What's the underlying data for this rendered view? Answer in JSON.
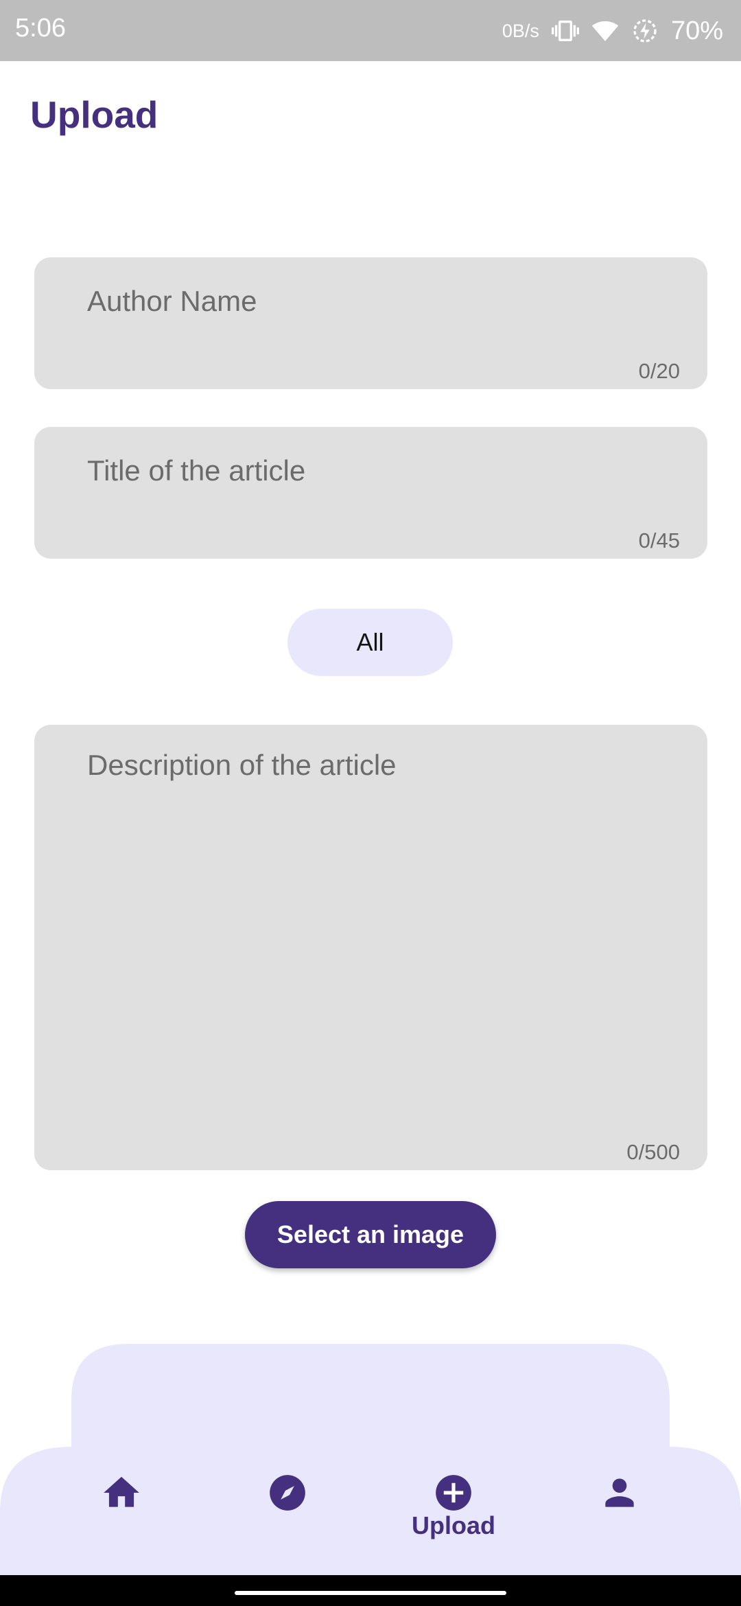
{
  "status_bar": {
    "time": "5:06",
    "network_speed": "0B/s",
    "battery": "70%",
    "icons": [
      "vibrate-icon",
      "wifi-icon",
      "battery-saver-icon"
    ]
  },
  "header": {
    "title": "Upload"
  },
  "form": {
    "author": {
      "placeholder": "Author Name",
      "value": "",
      "counter": "0/20"
    },
    "title": {
      "placeholder": "Title of the article",
      "value": "",
      "counter": "0/45"
    },
    "category": {
      "selected": "All"
    },
    "description": {
      "placeholder": "Description of the article",
      "value": "",
      "counter": "0/500"
    },
    "select_image_label": "Select an image"
  },
  "bottom_nav": {
    "items": [
      {
        "icon": "home-icon",
        "label": ""
      },
      {
        "icon": "explore-icon",
        "label": ""
      },
      {
        "icon": "add-circle-icon",
        "label": "Upload",
        "active": true
      },
      {
        "icon": "person-icon",
        "label": ""
      }
    ],
    "active_label": "Upload"
  },
  "colors": {
    "primary": "#45307f",
    "chip_background": "#e9e7fb",
    "field_background": "#e0e0e0",
    "status_bar": "#bdbdbd"
  }
}
